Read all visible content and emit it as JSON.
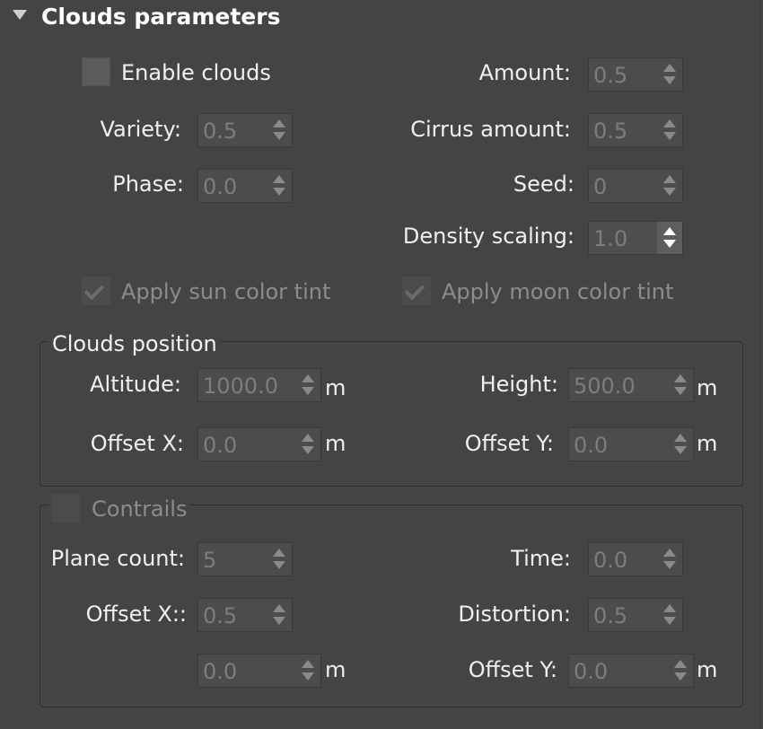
{
  "panel": {
    "title": "Clouds parameters"
  },
  "enable_clouds": {
    "label": "Enable clouds",
    "checked": false
  },
  "variety": {
    "label": "Variety:",
    "value": "0.5"
  },
  "phase": {
    "label": "Phase:",
    "value": "0.0"
  },
  "amount": {
    "label": "Amount:",
    "value": "0.5"
  },
  "cirrus_amount": {
    "label": "Cirrus amount:",
    "value": "0.5"
  },
  "seed": {
    "label": "Seed:",
    "value": "0"
  },
  "density_scaling": {
    "label": "Density scaling:",
    "value": "1.0"
  },
  "sun_tint": {
    "label": "Apply sun color tint",
    "checked": true
  },
  "moon_tint": {
    "label": "Apply moon color tint",
    "checked": true
  },
  "clouds_position": {
    "title": "Clouds position",
    "altitude": {
      "label": "Altitude:",
      "value": "1000.0",
      "unit": "m"
    },
    "height": {
      "label": "Height:",
      "value": "500.0",
      "unit": "m"
    },
    "offset_x": {
      "label": "Offset X:",
      "value": "0.0",
      "unit": "m"
    },
    "offset_y": {
      "label": "Offset Y:",
      "value": "0.0",
      "unit": "m"
    }
  },
  "contrails": {
    "title": "Contrails",
    "enabled": false,
    "plane_count": {
      "label": "Plane count:",
      "value": "5"
    },
    "time": {
      "label": "Time:",
      "value": "0.0"
    },
    "offset_x": {
      "label": "Offset X::",
      "value": "0.5"
    },
    "offset_x2": {
      "value": "0.0",
      "unit": "m"
    },
    "distortion": {
      "label": "Distortion:",
      "value": "0.5"
    },
    "offset_y": {
      "label": "Offset Y:",
      "value": "0.0",
      "unit": "m"
    }
  },
  "colors": {
    "background": "#444444",
    "field": "#4c4c4c",
    "text": "#f0f0f0",
    "disabled_text": "#8c8c8c"
  }
}
